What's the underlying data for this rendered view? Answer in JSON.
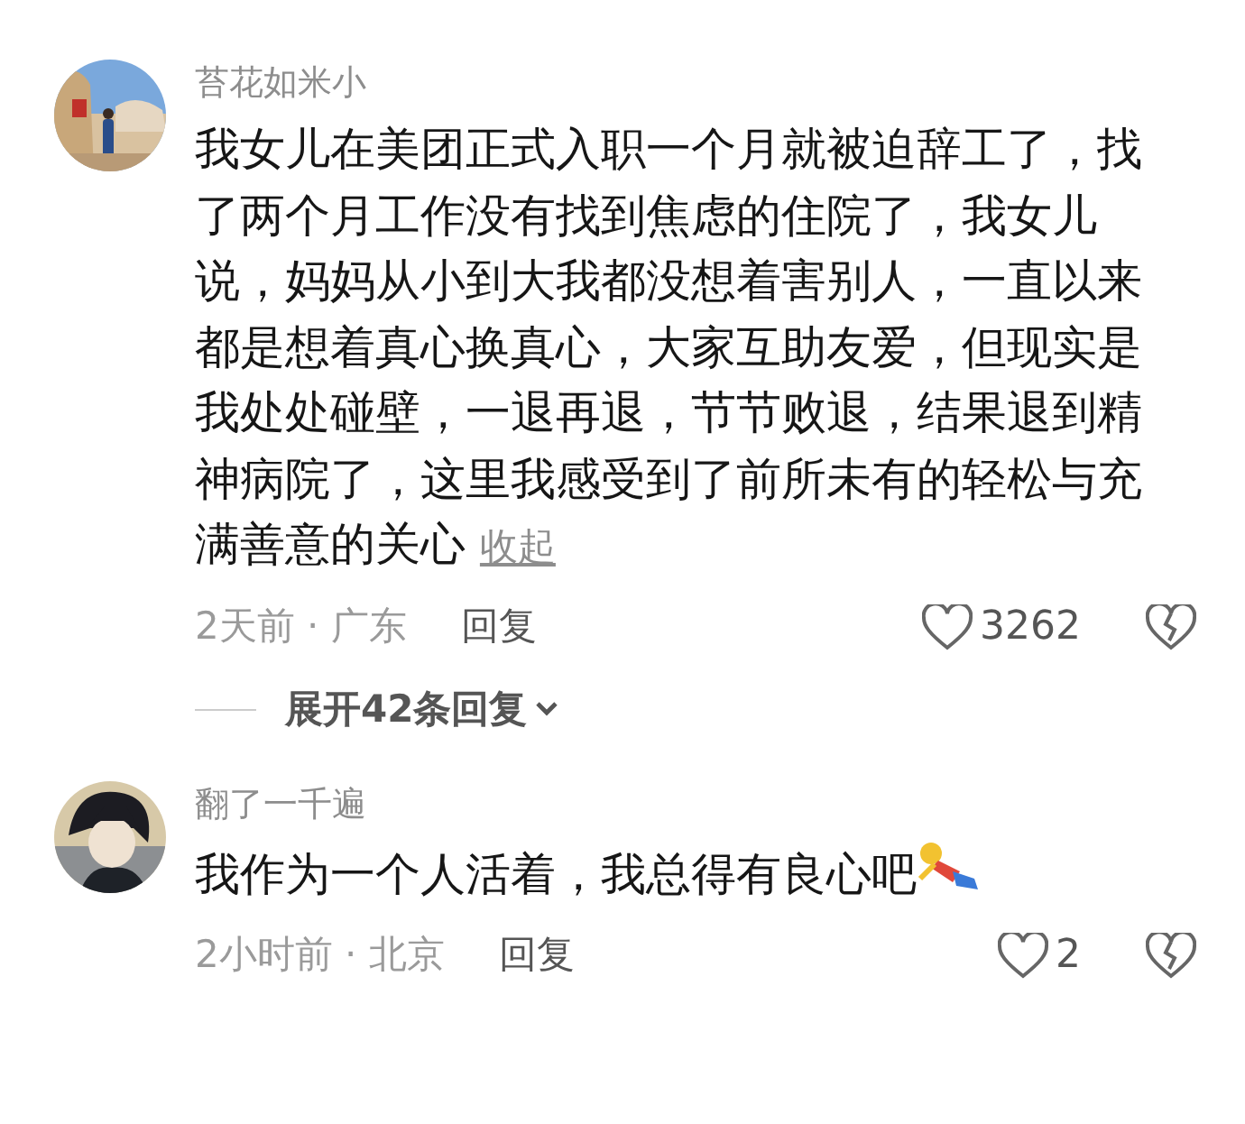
{
  "comments": [
    {
      "name": "苔花如米小",
      "text": "我女儿在美团正式入职一个月就被迫辞工了，找了两个月工作没有找到焦虑的住院了，我女儿说，妈妈从小到大我都没想着害别人，一直以来都是想着真心换真心，大家互助友爱，但现实是我处处碰壁，一退再退，节节败退，结果退到精神病院了，这里我感受到了前所未有的轻松与充满善意的关心",
      "collapse": "收起",
      "sticker": false,
      "meta": "2天前 · 广东",
      "reply": "回复",
      "likes": "3262",
      "expand": "展开42条回复"
    },
    {
      "name": "翻了一千遍",
      "text": "我作为一个人活着，我总得有良心吧",
      "sticker": true,
      "meta": "2小时前 · 北京",
      "reply": "回复",
      "likes": "2"
    }
  ]
}
